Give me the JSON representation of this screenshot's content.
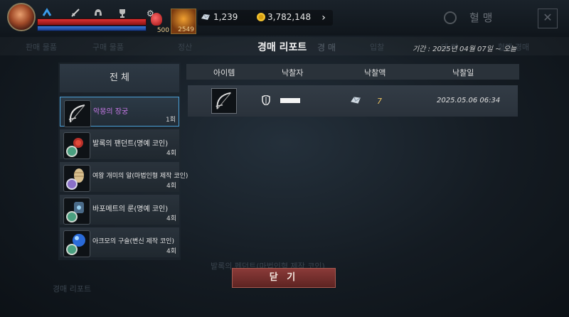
{
  "hud": {
    "potion_count": "500",
    "skill_count": "2549",
    "crystal_amount": "1,239",
    "gold_amount": "3,782,148",
    "more_glyph": "›",
    "gear_glyph": "⚙",
    "top_icons": [
      "chevron-up-icon",
      "sword-icon",
      "helmet-icon",
      "trophy-icon"
    ]
  },
  "background": {
    "guild_title": "혈 맹",
    "tabs": [
      "판매 물품",
      "구매 물품",
      "정산",
      "경매",
      "입찰",
      "대 여",
      "혈맹 경매"
    ],
    "bottom_text_1": "발록의 펜던트(마법인형 제작 코인)",
    "bottom_text_2": "경매 리포트"
  },
  "dialog": {
    "title": "경매 리포트",
    "subtitle": "경 매",
    "period": "기간 : 2025년 04월 07일 ~ 오늘",
    "all_tab": "전 체",
    "close_button": "닫 기"
  },
  "items": [
    {
      "name": "악몽의 장궁",
      "count": "1회",
      "icon": "bow-icon",
      "selected": true
    },
    {
      "name": "발록의 팬던트(명예 코인)",
      "count": "4회",
      "icon": "pendant-coin-icon",
      "selected": false
    },
    {
      "name": "여왕 개미의 알(마법인형 제작 코인)",
      "count": "4회",
      "icon": "ant-egg-coin-icon",
      "selected": false
    },
    {
      "name": "바포메트의 룬(명예 코인)",
      "count": "4회",
      "icon": "rune-coin-icon",
      "selected": false
    },
    {
      "name": "아크모의 구슬(변신 제작 코인)",
      "count": "4회",
      "icon": "orb-coin-icon",
      "selected": false
    }
  ],
  "table": {
    "headers": [
      "아이템",
      "낙찰자",
      "낙찰액",
      "낙찰일"
    ],
    "rows": [
      {
        "item_icon": "bow-icon",
        "bidder_icon": "shield-icon",
        "price": "7",
        "price_icon": "crystal-icon",
        "date": "2025.05.06 06:34"
      }
    ]
  },
  "colors": {
    "accent_selected": "#4aa0d8",
    "selected_name": "#c87ae8",
    "price": "#e8c060",
    "close_button": "#7a302e"
  }
}
